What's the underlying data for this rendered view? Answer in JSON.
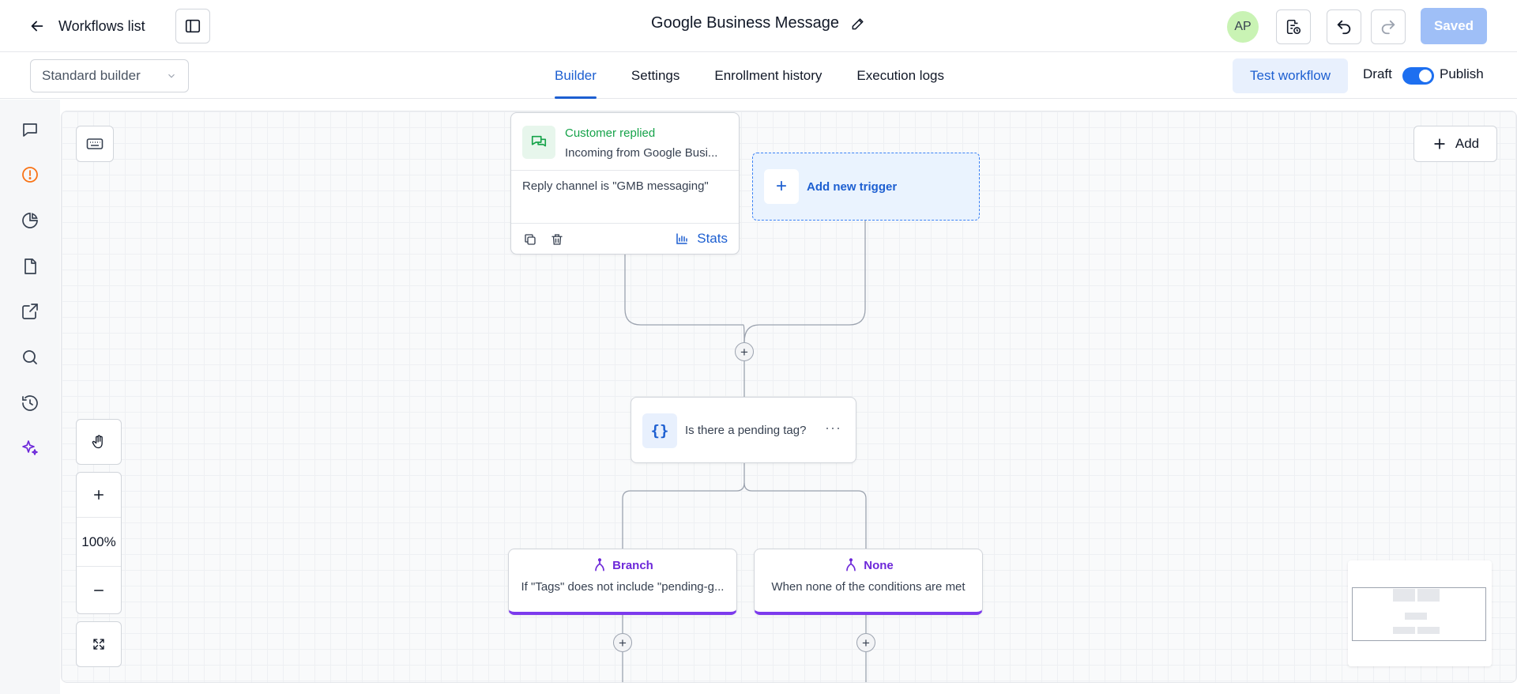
{
  "header": {
    "back_label": "Workflows list",
    "workflow_title": "Google Business Message",
    "avatar_initials": "AP",
    "saved_label": "Saved"
  },
  "subbar": {
    "builder_select": "Standard builder",
    "tabs": [
      {
        "label": "Builder",
        "active": true
      },
      {
        "label": "Settings",
        "active": false
      },
      {
        "label": "Enrollment history",
        "active": false
      },
      {
        "label": "Execution logs",
        "active": false
      }
    ],
    "test_label": "Test workflow",
    "draft_label": "Draft",
    "publish_label": "Publish",
    "publish_toggle_on": true
  },
  "rail": {
    "icons": [
      "chat-icon",
      "alert-icon",
      "pie-chart-icon",
      "document-icon",
      "external-link-icon",
      "search-icon",
      "history-icon",
      "sparkles-icon"
    ]
  },
  "canvas": {
    "add_label": "Add",
    "zoom_level": "100%",
    "trigger": {
      "title": "Customer replied",
      "subtitle": "Incoming from Google Busi...",
      "condition": "Reply channel is \"GMB messaging\"",
      "stats_label": "Stats"
    },
    "new_trigger_label": "Add new trigger",
    "condition_node": {
      "label": "Is there a pending tag?"
    },
    "branches": [
      {
        "title": "Branch",
        "subtitle": "If \"Tags\" does not include \"pending-g..."
      },
      {
        "title": "None",
        "subtitle": "When none of the conditions are met"
      }
    ]
  },
  "colors": {
    "accent": "#1d5fd1",
    "trigger_green": "#16a34a",
    "branch_purple": "#7c3aed",
    "saved_disabled": "#9fbff7"
  }
}
